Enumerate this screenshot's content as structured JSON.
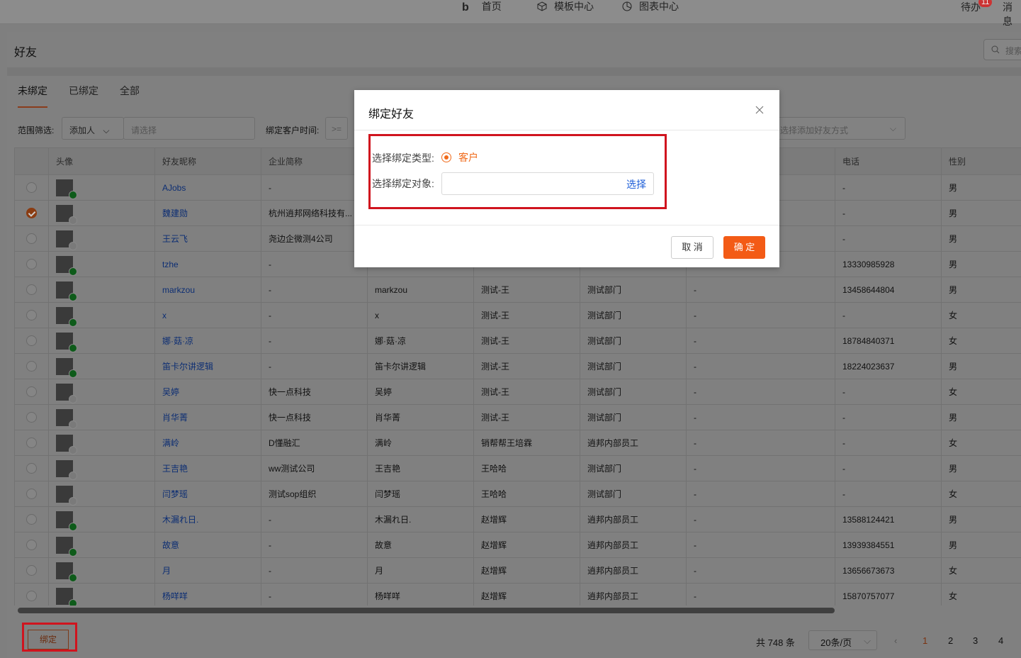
{
  "nav": {
    "home": "首页",
    "templates": "模板中心",
    "charts": "图表中心",
    "todo": "待办",
    "todo_badge": "11",
    "messages": "消息"
  },
  "page": {
    "title": "好友",
    "search_placeholder": "搜索"
  },
  "tabs": [
    "未绑定",
    "已绑定",
    "全部"
  ],
  "filters": {
    "scope_label": "范围筛选:",
    "adder_select": "添加人",
    "adder_placeholder": "请选择",
    "bind_time_label": "绑定客户时间:",
    "operator": ">=",
    "add_method_placeholder": "选择添加好友方式"
  },
  "table": {
    "headers": [
      "",
      "头像",
      "好友昵称",
      "企业简称",
      "",
      "",
      "",
      "",
      "电话",
      "性别"
    ],
    "rows": [
      {
        "checked": false,
        "avatar_status": "wechat",
        "nick": "AJobs",
        "company": "-",
        "remark": "",
        "owner": "",
        "dept": "",
        "tag": "",
        "phone": "-",
        "gender": "男"
      },
      {
        "checked": true,
        "avatar_status": "qq",
        "nick": "魏建勋",
        "company": "杭州逍邦网络科技有...",
        "remark": "",
        "owner": "",
        "dept": "",
        "tag": "",
        "phone": "-",
        "gender": "男"
      },
      {
        "checked": false,
        "avatar_status": "qq",
        "nick": "王云飞",
        "company": "尧边企微测4公司",
        "remark": "",
        "owner": "",
        "dept": "",
        "tag": "",
        "phone": "-",
        "gender": "男"
      },
      {
        "checked": false,
        "avatar_status": "wechat",
        "nick": "tzhe",
        "company": "-",
        "remark": "",
        "owner": "",
        "dept": "",
        "tag": "",
        "phone": "13330985928",
        "gender": "男"
      },
      {
        "checked": false,
        "avatar_status": "wechat",
        "nick": "markzou",
        "company": "-",
        "remark": "markzou",
        "owner": "测试-王",
        "dept": "测试部门",
        "tag": "-",
        "phone": "13458644804",
        "gender": "男"
      },
      {
        "checked": false,
        "avatar_status": "wechat",
        "nick": "x",
        "company": "-",
        "remark": "x",
        "owner": "测试-王",
        "dept": "测试部门",
        "tag": "-",
        "phone": "-",
        "gender": "女"
      },
      {
        "checked": false,
        "avatar_status": "wechat",
        "nick": "娜·菇·凉",
        "company": "-",
        "remark": "娜·菇·凉",
        "owner": "测试-王",
        "dept": "测试部门",
        "tag": "-",
        "phone": "18784840371",
        "gender": "女"
      },
      {
        "checked": false,
        "avatar_status": "wechat",
        "nick": "笛卡尔讲逻辑",
        "company": "-",
        "remark": "笛卡尔讲逻辑",
        "owner": "测试-王",
        "dept": "测试部门",
        "tag": "-",
        "phone": "18224023637",
        "gender": "男"
      },
      {
        "checked": false,
        "avatar_status": "qq",
        "nick": "吴婷",
        "company": "快一点科技",
        "remark": "吴婷",
        "owner": "测试-王",
        "dept": "测试部门",
        "tag": "-",
        "phone": "-",
        "gender": "女"
      },
      {
        "checked": false,
        "avatar_status": "qq",
        "nick": "肖华菁",
        "company": "快一点科技",
        "remark": "肖华菁",
        "owner": "测试-王",
        "dept": "测试部门",
        "tag": "-",
        "phone": "-",
        "gender": "男"
      },
      {
        "checked": false,
        "avatar_status": "qq",
        "nick": "满岭",
        "company": "D懂融汇",
        "remark": "满岭",
        "owner": "销帮帮王培霖",
        "dept": "逍邦内部员工",
        "tag": "-",
        "phone": "-",
        "gender": "女"
      },
      {
        "checked": false,
        "avatar_status": "qq",
        "nick": "王吉艳",
        "company": "ww测试公司",
        "remark": "王吉艳",
        "owner": "王哈哈",
        "dept": "测试部门",
        "tag": "-",
        "phone": "-",
        "gender": "男"
      },
      {
        "checked": false,
        "avatar_status": "qq",
        "nick": "闫梦瑶",
        "company": "测试sop组织",
        "remark": "闫梦瑶",
        "owner": "王哈哈",
        "dept": "测试部门",
        "tag": "-",
        "phone": "-",
        "gender": "女"
      },
      {
        "checked": false,
        "avatar_status": "wechat",
        "nick": "木漏れ日.",
        "company": "-",
        "remark": "木漏れ日.",
        "owner": "赵增辉",
        "dept": "逍邦内部员工",
        "tag": "-",
        "phone": "13588124421",
        "gender": "男"
      },
      {
        "checked": false,
        "avatar_status": "wechat",
        "nick": "故意",
        "company": "-",
        "remark": "故意",
        "owner": "赵增辉",
        "dept": "逍邦内部员工",
        "tag": "-",
        "phone": "13939384551",
        "gender": "男"
      },
      {
        "checked": false,
        "avatar_status": "wechat",
        "nick": "月",
        "company": "-",
        "remark": "月",
        "owner": "赵增辉",
        "dept": "逍邦内部员工",
        "tag": "-",
        "phone": "13656673673",
        "gender": "女"
      },
      {
        "checked": false,
        "avatar_status": "wechat",
        "nick": "杨咩咩",
        "company": "-",
        "remark": "杨咩咩",
        "owner": "赵增辉",
        "dept": "逍邦内部员工",
        "tag": "-",
        "phone": "15870757077",
        "gender": "女"
      }
    ]
  },
  "footer": {
    "bind_button": "绑定",
    "total": "共 748 条",
    "page_size": "20条/页",
    "pages": [
      "1",
      "2",
      "3",
      "4"
    ],
    "current_page": "1"
  },
  "modal": {
    "title": "绑定好友",
    "type_label": "选择绑定类型:",
    "type_option": "客户",
    "target_label": "选择绑定对象:",
    "select_link": "选择",
    "cancel": "取 消",
    "confirm": "确 定"
  },
  "colors": {
    "accent": "#f35b16",
    "link": "#1f5fd8",
    "highlight_box": "#d0141e"
  }
}
